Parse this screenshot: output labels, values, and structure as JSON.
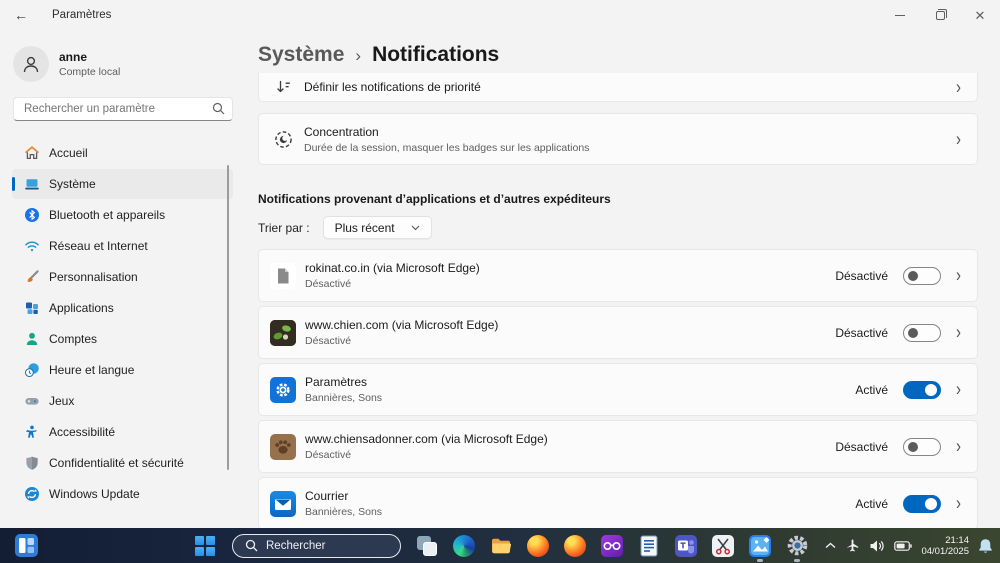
{
  "window": {
    "title": "Paramètres",
    "back_icon": "back-arrow-icon",
    "controls": {
      "minimize": "minimize",
      "maximize": "maximize",
      "close": "close"
    }
  },
  "sidebar": {
    "user": {
      "name": "anne",
      "account_type": "Compte local",
      "avatar_icon": "person-icon"
    },
    "search": {
      "placeholder": "Rechercher un paramètre",
      "icon": "search-icon"
    },
    "items": [
      {
        "label": "Accueil",
        "icon": "home-icon",
        "selected": false
      },
      {
        "label": "Système",
        "icon": "system-icon",
        "selected": true
      },
      {
        "label": "Bluetooth et appareils",
        "icon": "bluetooth-icon",
        "selected": false
      },
      {
        "label": "Réseau et Internet",
        "icon": "network-icon",
        "selected": false
      },
      {
        "label": "Personnalisation",
        "icon": "personalization-icon",
        "selected": false
      },
      {
        "label": "Applications",
        "icon": "apps-icon",
        "selected": false
      },
      {
        "label": "Comptes",
        "icon": "accounts-icon",
        "selected": false
      },
      {
        "label": "Heure et langue",
        "icon": "time-language-icon",
        "selected": false
      },
      {
        "label": "Jeux",
        "icon": "gaming-icon",
        "selected": false
      },
      {
        "label": "Accessibilité",
        "icon": "accessibility-icon",
        "selected": false
      },
      {
        "label": "Confidentialité et sécurité",
        "icon": "privacy-icon",
        "selected": false
      },
      {
        "label": "Windows Update",
        "icon": "windows-update-icon",
        "selected": false
      }
    ]
  },
  "main": {
    "breadcrumb": {
      "parent": "Système",
      "separator": "›",
      "current": "Notifications"
    },
    "rows": [
      {
        "title": "Définir les notifications de priorité",
        "icon": "priority-sort-icon"
      },
      {
        "title": "Concentration",
        "subtitle": "Durée de la session, masquer les badges sur les applications",
        "icon": "focus-icon"
      }
    ],
    "section_title": "Notifications provenant d’applications et d’autres expéditeurs",
    "sort": {
      "label": "Trier par :",
      "value": "Plus récent"
    },
    "apps": [
      {
        "name": "rokinat.co.in (via Microsoft Edge)",
        "subtitle": "Désactivé",
        "status": "Désactivé",
        "enabled": false,
        "icon": "webpage-icon"
      },
      {
        "name": "www.chien.com (via Microsoft Edge)",
        "subtitle": "Désactivé",
        "status": "Désactivé",
        "enabled": false,
        "icon": "chien-site-icon"
      },
      {
        "name": "Paramètres",
        "subtitle": "Bannières, Sons",
        "status": "Activé",
        "enabled": true,
        "icon": "settings-app-icon"
      },
      {
        "name": "www.chiensadonner.com (via Microsoft Edge)",
        "subtitle": "Désactivé",
        "status": "Désactivé",
        "enabled": false,
        "icon": "paw-icon"
      },
      {
        "name": "Courrier",
        "subtitle": "Bannières, Sons",
        "status": "Activé",
        "enabled": true,
        "icon": "mail-icon"
      }
    ]
  },
  "taskbar": {
    "widgets_icon": "widgets-icon",
    "start_icon": "windows-start-icon",
    "search": {
      "placeholder": "Rechercher",
      "icon": "search-icon"
    },
    "app_icons": [
      "task-view-icon",
      "edge-icon",
      "file-explorer-icon",
      "firefox-icon",
      "firefox-icon",
      "purple-glasses-app-icon",
      "writer-icon",
      "teams-icon",
      "snipping-tool-icon",
      "photos-icon",
      "settings-gear-icon"
    ],
    "tray": {
      "hidden_icons": "chevron-up-icon",
      "airplane": "airplane-icon",
      "volume": "volume-icon",
      "battery": "battery-icon",
      "time": "21:14",
      "date": "04/01/2025",
      "bell": "notification-bell-icon"
    }
  },
  "colors": {
    "accent": "#0067C0",
    "toggle_on": "#0067C0",
    "page_bg": "#F3F3F3",
    "card_bg": "#FBFBFB",
    "taskbar_left": "#131E35",
    "taskbar_right": "#3A462F"
  }
}
